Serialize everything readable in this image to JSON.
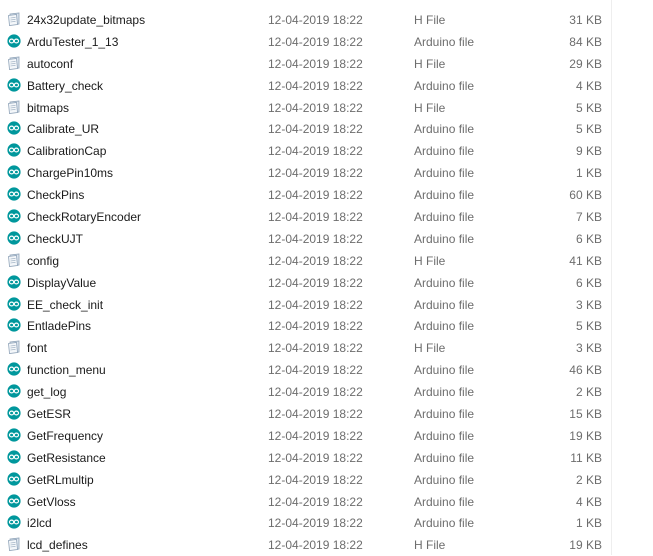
{
  "files": [
    {
      "name": "24x32update_bitmaps",
      "date": "12-04-2019 18:22",
      "type": "H File",
      "size": "31 KB",
      "icon": "h-file-icon"
    },
    {
      "name": "ArduTester_1_13",
      "date": "12-04-2019 18:22",
      "type": "Arduino file",
      "size": "84 KB",
      "icon": "arduino-file-icon"
    },
    {
      "name": "autoconf",
      "date": "12-04-2019 18:22",
      "type": "H File",
      "size": "29 KB",
      "icon": "h-file-icon"
    },
    {
      "name": "Battery_check",
      "date": "12-04-2019 18:22",
      "type": "Arduino file",
      "size": "4 KB",
      "icon": "arduino-file-icon"
    },
    {
      "name": "bitmaps",
      "date": "12-04-2019 18:22",
      "type": "H File",
      "size": "5 KB",
      "icon": "h-file-icon"
    },
    {
      "name": "Calibrate_UR",
      "date": "12-04-2019 18:22",
      "type": "Arduino file",
      "size": "5 KB",
      "icon": "arduino-file-icon"
    },
    {
      "name": "CalibrationCap",
      "date": "12-04-2019 18:22",
      "type": "Arduino file",
      "size": "9 KB",
      "icon": "arduino-file-icon"
    },
    {
      "name": "ChargePin10ms",
      "date": "12-04-2019 18:22",
      "type": "Arduino file",
      "size": "1 KB",
      "icon": "arduino-file-icon"
    },
    {
      "name": "CheckPins",
      "date": "12-04-2019 18:22",
      "type": "Arduino file",
      "size": "60 KB",
      "icon": "arduino-file-icon"
    },
    {
      "name": "CheckRotaryEncoder",
      "date": "12-04-2019 18:22",
      "type": "Arduino file",
      "size": "7 KB",
      "icon": "arduino-file-icon"
    },
    {
      "name": "CheckUJT",
      "date": "12-04-2019 18:22",
      "type": "Arduino file",
      "size": "6 KB",
      "icon": "arduino-file-icon"
    },
    {
      "name": "config",
      "date": "12-04-2019 18:22",
      "type": "H File",
      "size": "41 KB",
      "icon": "h-file-icon"
    },
    {
      "name": "DisplayValue",
      "date": "12-04-2019 18:22",
      "type": "Arduino file",
      "size": "6 KB",
      "icon": "arduino-file-icon"
    },
    {
      "name": "EE_check_init",
      "date": "12-04-2019 18:22",
      "type": "Arduino file",
      "size": "3 KB",
      "icon": "arduino-file-icon"
    },
    {
      "name": "EntladePins",
      "date": "12-04-2019 18:22",
      "type": "Arduino file",
      "size": "5 KB",
      "icon": "arduino-file-icon"
    },
    {
      "name": "font",
      "date": "12-04-2019 18:22",
      "type": "H File",
      "size": "3 KB",
      "icon": "h-file-icon"
    },
    {
      "name": "function_menu",
      "date": "12-04-2019 18:22",
      "type": "Arduino file",
      "size": "46 KB",
      "icon": "arduino-file-icon"
    },
    {
      "name": "get_log",
      "date": "12-04-2019 18:22",
      "type": "Arduino file",
      "size": "2 KB",
      "icon": "arduino-file-icon"
    },
    {
      "name": "GetESR",
      "date": "12-04-2019 18:22",
      "type": "Arduino file",
      "size": "15 KB",
      "icon": "arduino-file-icon"
    },
    {
      "name": "GetFrequency",
      "date": "12-04-2019 18:22",
      "type": "Arduino file",
      "size": "19 KB",
      "icon": "arduino-file-icon"
    },
    {
      "name": "GetResistance",
      "date": "12-04-2019 18:22",
      "type": "Arduino file",
      "size": "11 KB",
      "icon": "arduino-file-icon"
    },
    {
      "name": "GetRLmultip",
      "date": "12-04-2019 18:22",
      "type": "Arduino file",
      "size": "2 KB",
      "icon": "arduino-file-icon"
    },
    {
      "name": "GetVloss",
      "date": "12-04-2019 18:22",
      "type": "Arduino file",
      "size": "4 KB",
      "icon": "arduino-file-icon"
    },
    {
      "name": "i2lcd",
      "date": "12-04-2019 18:22",
      "type": "Arduino file",
      "size": "1 KB",
      "icon": "arduino-file-icon"
    },
    {
      "name": "lcd_defines",
      "date": "12-04-2019 18:22",
      "type": "H File",
      "size": "19 KB",
      "icon": "h-file-icon"
    }
  ],
  "colors": {
    "arduino_icon": "#00979c",
    "h_file_icon_light": "#dbe4ee",
    "h_file_icon_dark": "#8fa3b8",
    "row_hover": "#e5f3ff"
  }
}
